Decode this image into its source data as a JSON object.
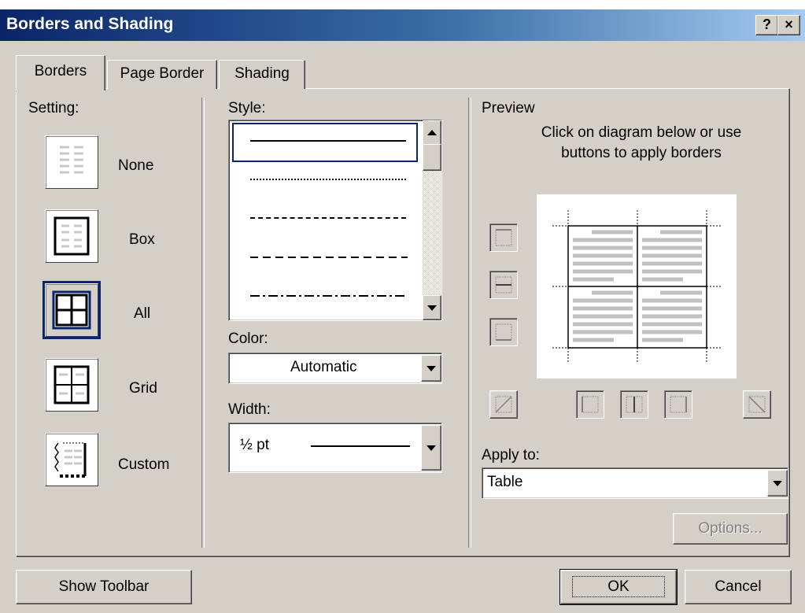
{
  "window": {
    "title": "Borders and Shading",
    "help_btn": "?",
    "close_btn": "×"
  },
  "tabs": [
    {
      "label": "Borders"
    },
    {
      "label": "Page Border"
    },
    {
      "label": "Shading"
    }
  ],
  "setting": {
    "label": "Setting:",
    "items": [
      {
        "label": "None"
      },
      {
        "label": "Box"
      },
      {
        "label": "All",
        "selected": true
      },
      {
        "label": "Grid"
      },
      {
        "label": "Custom"
      }
    ]
  },
  "style": {
    "label": "Style:",
    "line_styles": [
      "solid",
      "dotted-fine",
      "dashed-short",
      "dashed",
      "dash-dot"
    ]
  },
  "color": {
    "label": "Color:",
    "value": "Automatic"
  },
  "width": {
    "label": "Width:",
    "value": "½ pt"
  },
  "preview": {
    "label": "Preview",
    "instructions_line1": "Click on diagram below or use",
    "instructions_line2": "buttons to apply borders"
  },
  "apply_to": {
    "label": "Apply to:",
    "value": "Table"
  },
  "buttons": {
    "options": "Options...",
    "show_toolbar": "Show Toolbar",
    "ok": "OK",
    "cancel": "Cancel"
  },
  "colors": {
    "title_start": "#0a246a",
    "title_end": "#a6caf0",
    "face": "#d4d0c8",
    "selected_border": "#0a246a"
  }
}
